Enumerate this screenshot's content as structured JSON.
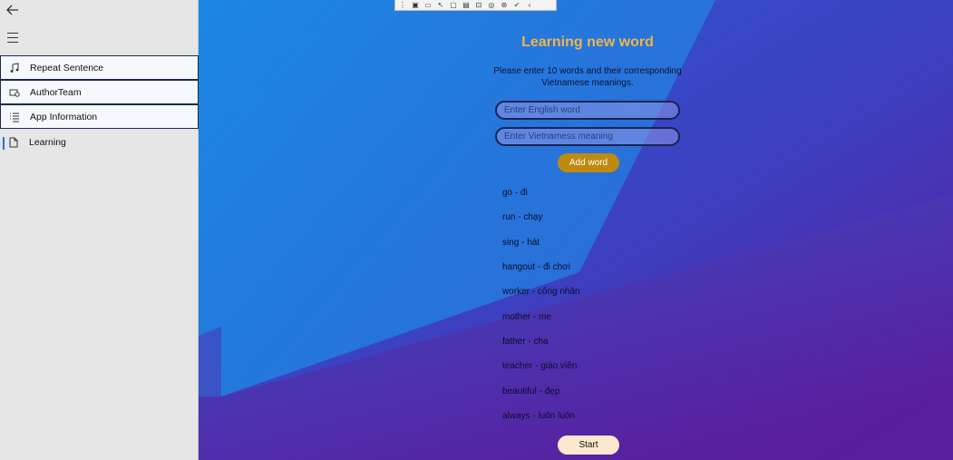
{
  "nav": {
    "back_icon": "back-arrow-icon",
    "menu_icon": "hamburger-menu-icon",
    "items": [
      {
        "label": "Repeat Sentence",
        "icon": "music-notes-icon"
      },
      {
        "label": "AuthorTeam",
        "icon": "team-card-icon"
      },
      {
        "label": "App Information",
        "icon": "list-icon"
      },
      {
        "label": "Learning",
        "icon": "document-icon"
      }
    ]
  },
  "toolbar": {
    "icons": [
      "grip-icon",
      "select-element-icon",
      "record-icon",
      "pointer-icon",
      "frame-icon",
      "layout-icon",
      "inspect-icon",
      "binding-icon",
      "accessibility-icon",
      "check-icon",
      "collapse-icon"
    ]
  },
  "main": {
    "title": "Learning new word",
    "instructions": "Please enter 10 words and their corresponding Vietnamese meanings.",
    "english_placeholder": "Enter English word",
    "vietnamese_placeholder": "Enter Vietnamess meaning",
    "add_label": "Add word",
    "words": [
      "go - đi",
      "run - chạy",
      "sing - hát",
      "hangout - đi chơi",
      "worker - công nhân",
      "mother - mẹ",
      "father - cha",
      "teacher - giáo viên",
      "beautiful - đẹp",
      "always - luôn luôn"
    ],
    "start_label": "Start"
  },
  "colors": {
    "title": "#f0b44c",
    "add_button": "#c08a10",
    "start_button": "#fce7cf",
    "bg_blue": "#1e88e0",
    "bg_purple": "#5a1a9c"
  }
}
